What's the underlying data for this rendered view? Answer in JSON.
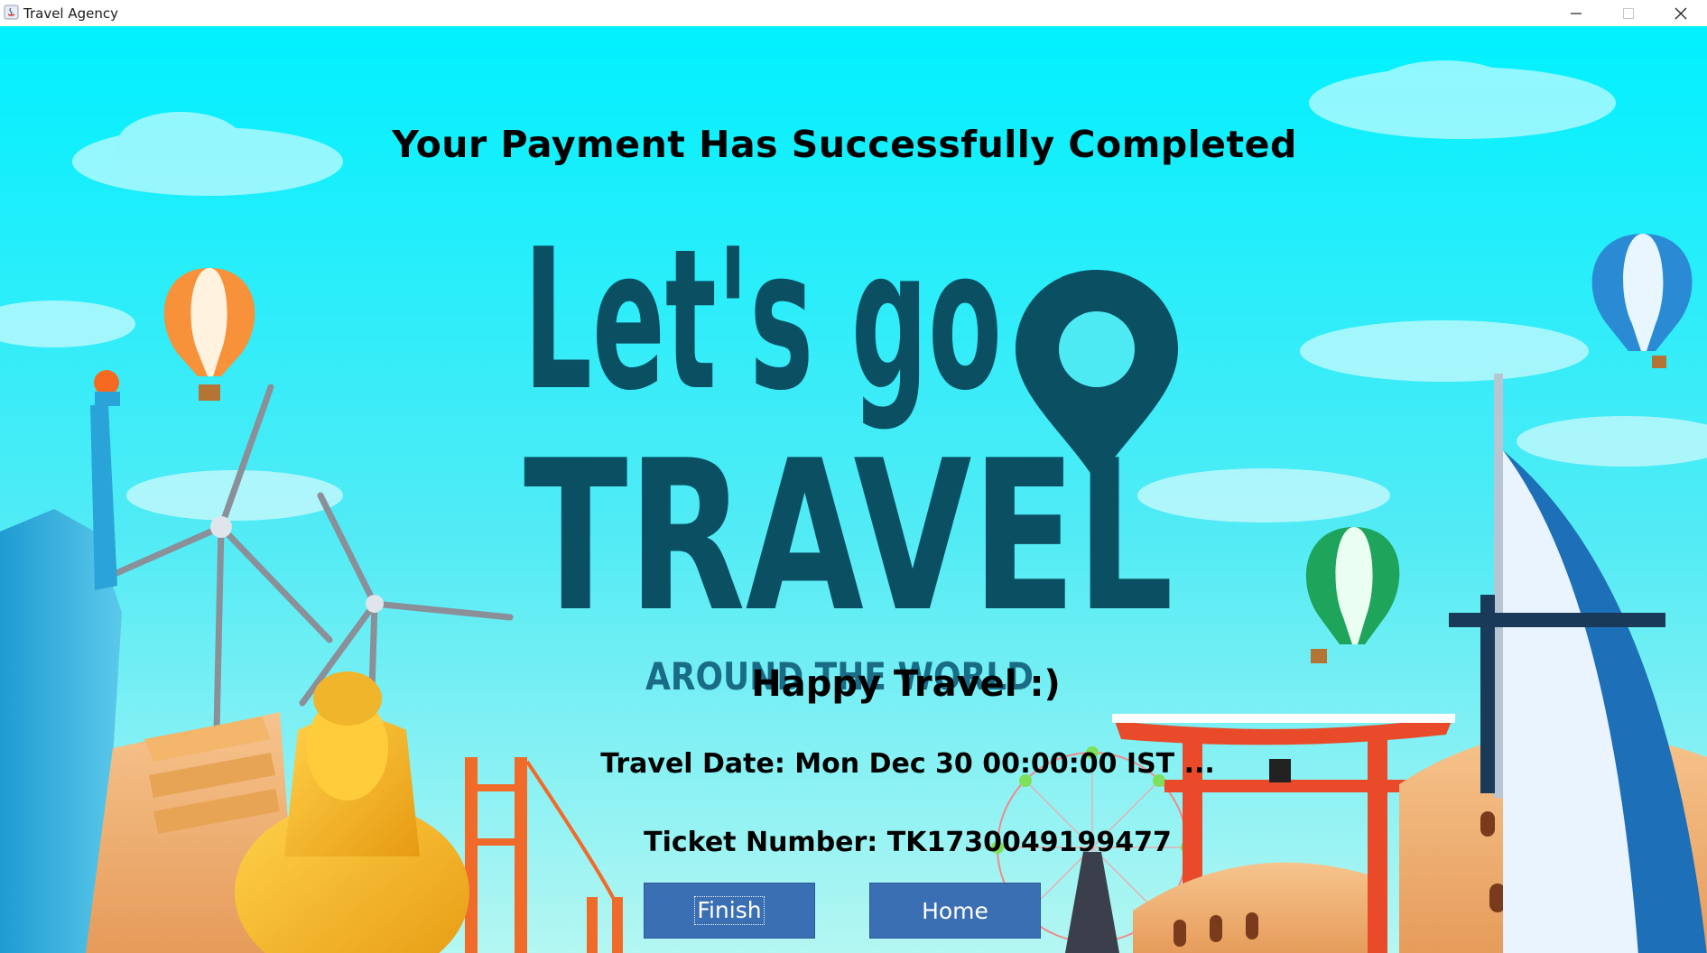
{
  "window": {
    "title": "Travel Agency",
    "controls": [
      "minimize-icon",
      "maximize-icon",
      "close-icon"
    ]
  },
  "main": {
    "heading": "Your Payment Has Successfully Completed",
    "logo": {
      "line1": "Let's go",
      "line2": "TRAVEL",
      "tagline": "AROUND THE WORLD"
    },
    "greeting": "Happy Travel :)",
    "travel_date": "Travel Date: Mon Dec 30 00:00:00 IST ...",
    "ticket_number": "Ticket Number: TK1730049199477"
  },
  "buttons": {
    "finish": "Finish",
    "home": "Home"
  },
  "colors": {
    "sky_top": "#00f0ff",
    "sky_bottom": "#9af4f6",
    "logo": "#0b4f63",
    "button": "#3b6fb3"
  }
}
